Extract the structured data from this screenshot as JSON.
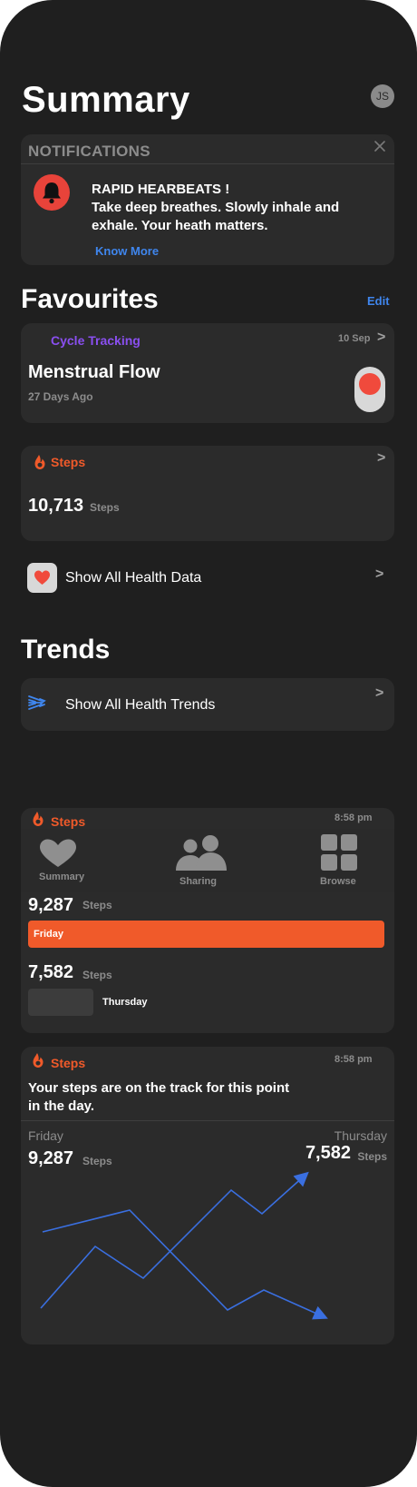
{
  "header": {
    "title": "Summary",
    "avatar_initials": "JS"
  },
  "notifications": {
    "heading": "NOTIFICATIONS",
    "alert_title": "RAPID HEARBEATS !",
    "alert_body_line1": "Take deep breathes. Slowly inhale and",
    "alert_body_line2": "exhale. Your heath matters.",
    "link": "Know More",
    "icon": "bell-icon",
    "icon_color": "#e8433a"
  },
  "favourites": {
    "title": "Favourites",
    "edit": "Edit",
    "cycle": {
      "category": "Cycle Tracking",
      "date": "10 Sep",
      "metric": "Menstrual Flow",
      "ago": "27 Days Ago",
      "accent": "#8a4ff0"
    },
    "steps": {
      "category": "Steps",
      "value": "10,713",
      "unit": "Steps"
    },
    "show_all": "Show All Health Data"
  },
  "trends": {
    "title": "Trends",
    "show_all": "Show All Health Trends"
  },
  "steps_compare_card": {
    "category": "Steps",
    "time": "8:58 pm",
    "row1_value": "9,287",
    "row1_unit": "Steps",
    "row1_label": "Friday",
    "row2_value": "7,582",
    "row2_unit": "Steps",
    "row2_label": "Thursday",
    "bar_color": "#f05a2a"
  },
  "tabbar": {
    "items": [
      {
        "label": "Summary",
        "icon": "heart-icon"
      },
      {
        "label": "Sharing",
        "icon": "people-icon"
      },
      {
        "label": "Browse",
        "icon": "grid-icon"
      }
    ]
  },
  "steps_trend_card": {
    "category": "Steps",
    "time": "8:58 pm",
    "message_line1": "Your steps are on the track for this point",
    "message_line2": "in the day.",
    "left_label": "Friday",
    "left_value": "9,287",
    "left_unit": "Steps",
    "right_label": "Thursday",
    "right_value": "7,582",
    "right_unit": "Steps",
    "line_color": "#3a6fe0"
  }
}
